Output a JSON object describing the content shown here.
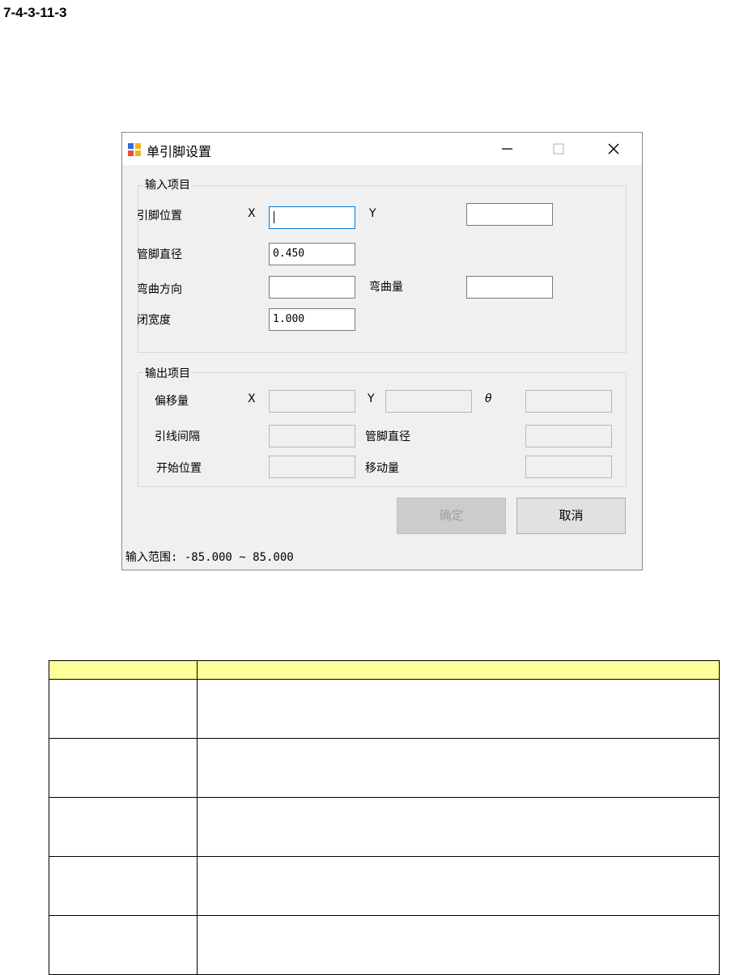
{
  "page_heading": "7-4-3-11-3",
  "window": {
    "title": "单引脚设置",
    "controls": {
      "minimize": "minimize-icon",
      "maximize": "maximize-icon",
      "close": "close-icon"
    }
  },
  "input_group": {
    "legend": "输入项目",
    "pin_position_label": "引脚位置",
    "x_label": "X",
    "x_value": "",
    "y_label": "Y",
    "y_value": "",
    "pin_diameter_label": "管脚直径",
    "pin_diameter_value": "0.450",
    "bend_direction_label": "弯曲方向",
    "bend_direction_value": "",
    "bend_amount_label": "弯曲量",
    "bend_amount_value": "",
    "close_width_label": "闭宽度",
    "close_width_value": "1.000"
  },
  "output_group": {
    "legend": "输出项目",
    "offset_label": "偏移量",
    "x_label": "X",
    "x_value": "",
    "y_label": "Y",
    "y_value": "",
    "theta_label": "θ",
    "theta_value": "",
    "lead_spacing_label": "引线间隔",
    "lead_spacing_value": "",
    "pin_diameter_label": "管脚直径",
    "pin_diameter_value": "",
    "start_position_label": "开始位置",
    "start_position_value": "",
    "move_amount_label": "移动量",
    "move_amount_value": ""
  },
  "buttons": {
    "ok": "确定",
    "cancel": "取消"
  },
  "status": {
    "text": "输入范围: -85.000 ~ 85.000"
  },
  "colors": {
    "table_header": "#ffff99",
    "focus_border": "#0078d7",
    "window_bg": "#f0f0f0"
  },
  "doc_table": {
    "headers": [
      "",
      ""
    ],
    "rows": [
      [
        "",
        ""
      ],
      [
        "",
        ""
      ],
      [
        "",
        ""
      ],
      [
        "",
        ""
      ],
      [
        "",
        ""
      ]
    ]
  }
}
